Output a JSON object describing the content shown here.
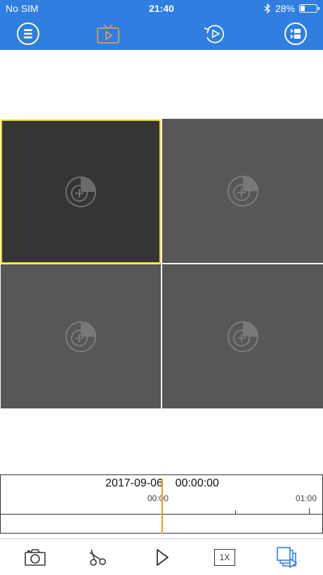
{
  "status_bar": {
    "carrier": "No SIM",
    "time": "21:40",
    "battery_percent": "28%",
    "battery_level": 0.28
  },
  "nav_bar": {
    "icons": [
      "menu-icon",
      "live-tv-icon",
      "playback-icon",
      "device-list-icon"
    ],
    "accent": "#2f7ee0"
  },
  "grid": {
    "cells": [
      {
        "id": "channel-1",
        "state": "empty",
        "selected": true
      },
      {
        "id": "channel-2",
        "state": "empty",
        "selected": false
      },
      {
        "id": "channel-3",
        "state": "empty",
        "selected": false
      },
      {
        "id": "channel-4",
        "state": "empty",
        "selected": false
      }
    ],
    "selected_border": "#f0d62a"
  },
  "timeline": {
    "date": "2017-09-06",
    "time": "00:00:00",
    "tick_start": "00:00",
    "tick_end": "01:00",
    "cursor_color": "#f39a1e"
  },
  "toolbar": {
    "icons": [
      "camera-icon",
      "scissors-icon",
      "play-icon",
      "speed-icon",
      "multi-window-icon"
    ],
    "speed_label": "1X",
    "active_color": "#2f7ee0"
  }
}
